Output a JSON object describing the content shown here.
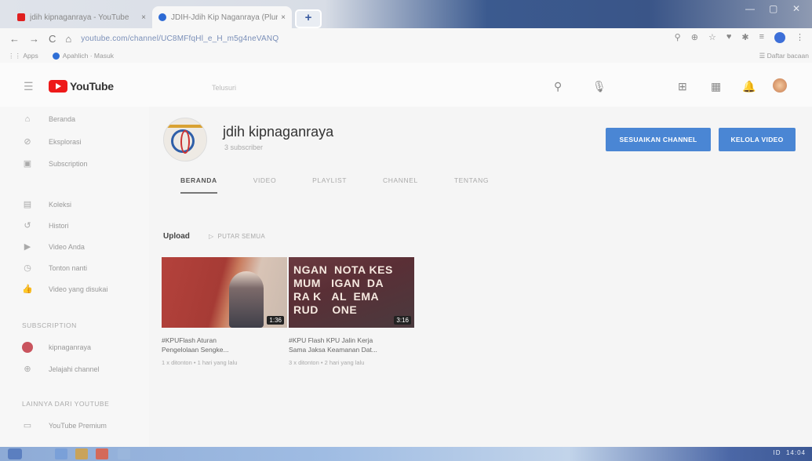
{
  "browser": {
    "tabs": [
      {
        "title": "jdih kipnaganraya - YouTube",
        "favicon_color": "#e02020"
      },
      {
        "title": "JDIH-Jdih Kip Naganraya (Plural...",
        "favicon_color": "#2d6ad4"
      }
    ],
    "new_tab_label": "+",
    "url": "youtube.com/channel/UC8MFfqHl_e_H_m5g4neVANQ",
    "bookmarks": [
      {
        "label": "Apps"
      },
      {
        "label": "Apahlich · Masuk"
      }
    ],
    "reading_list": "Daftar bacaan"
  },
  "masthead": {
    "logo_text": "YouTube",
    "search_placeholder": "Telusuri"
  },
  "sidebar": {
    "items": [
      {
        "icon": "home-icon",
        "glyph": "⌂",
        "label": "Beranda"
      },
      {
        "icon": "explore-icon",
        "glyph": "⊘",
        "label": "Eksplorasi"
      },
      {
        "icon": "subscriptions-icon",
        "glyph": "▣",
        "label": "Subscription"
      }
    ],
    "items2": [
      {
        "icon": "library-icon",
        "glyph": "▤",
        "label": "Koleksi"
      },
      {
        "icon": "history-icon",
        "glyph": "↺",
        "label": "Histori"
      },
      {
        "icon": "your-videos-icon",
        "glyph": "▶",
        "label": "Video Anda"
      },
      {
        "icon": "watch-later-icon",
        "glyph": "◷",
        "label": "Tonton nanti"
      },
      {
        "icon": "liked-videos-icon",
        "glyph": "👍",
        "label": "Video yang disukai"
      }
    ],
    "subscription_header": "SUBSCRIPTION",
    "subscriptions": [
      {
        "label": "kipnaganraya"
      },
      {
        "label": "Jelajahi channel"
      }
    ],
    "more_header": "LAINNYA DARI YOUTUBE",
    "more": [
      {
        "icon": "youtube-premium-icon",
        "glyph": "▭",
        "label": "YouTube Premium"
      }
    ]
  },
  "channel": {
    "name": "jdih kipnaganraya",
    "subscribers": "3 subscriber",
    "customize_button": "SESUAIKAN CHANNEL",
    "manage_button": "KELOLA VIDEO",
    "tabs": [
      "BERANDA",
      "VIDEO",
      "PLAYLIST",
      "CHANNEL",
      "TENTANG"
    ],
    "active_tab": "BERANDA"
  },
  "uploads": {
    "title": "Upload",
    "play_all": "PUTAR SEMUA",
    "videos": [
      {
        "title": "#KPUFlash Aturan Pengelolaan Dokumen Sengketa...",
        "title_line1": "#KPUFlash Aturan",
        "title_line2": "Pengelolaan Sengke...",
        "meta": "1 x ditonton • 1 hari yang lalu",
        "duration": "1:36"
      },
      {
        "title_line1": "#KPU Flash KPU Jalin Kerja",
        "title_line2": "Sama Jaksa Keamanan Dat...",
        "meta": "3 x ditonton • 2 hari yang lalu",
        "duration": "3:16",
        "thumb_text": "NGAN  NOTA KES\nMUM   IGAN  DA\nRA K   AL  EMA\nRUD    ONE"
      }
    ]
  },
  "taskbar": {
    "tray": "ID",
    "time": "14:04"
  }
}
